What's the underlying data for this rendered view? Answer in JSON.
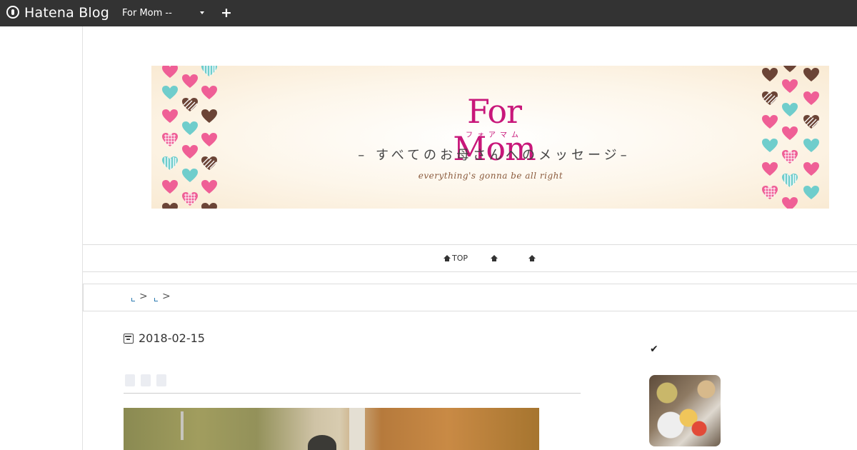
{
  "topbar": {
    "logo_text": "Hatena Blog",
    "blog_selector_value": "For Mom --",
    "add_label": "+"
  },
  "banner": {
    "title": "For Mom",
    "kana": "フォアマム",
    "subtitle": "– すべてのお母さんへのメッセージ–",
    "tagline": "everything's gonna be all right",
    "colors": {
      "pink": "#ef5f96",
      "teal": "#6fcdcc",
      "brown": "#6b4436",
      "title": "#c8177a"
    }
  },
  "global_nav": {
    "items": [
      {
        "label": "TOP",
        "icon": "home-icon"
      },
      {
        "label": "",
        "icon": "home-icon"
      },
      {
        "label": "",
        "icon": "home-icon"
      }
    ]
  },
  "breadcrumb": {
    "separator": ">"
  },
  "article": {
    "date": "2018-02-15"
  },
  "sidebar": {
    "icon": "check-icon"
  }
}
